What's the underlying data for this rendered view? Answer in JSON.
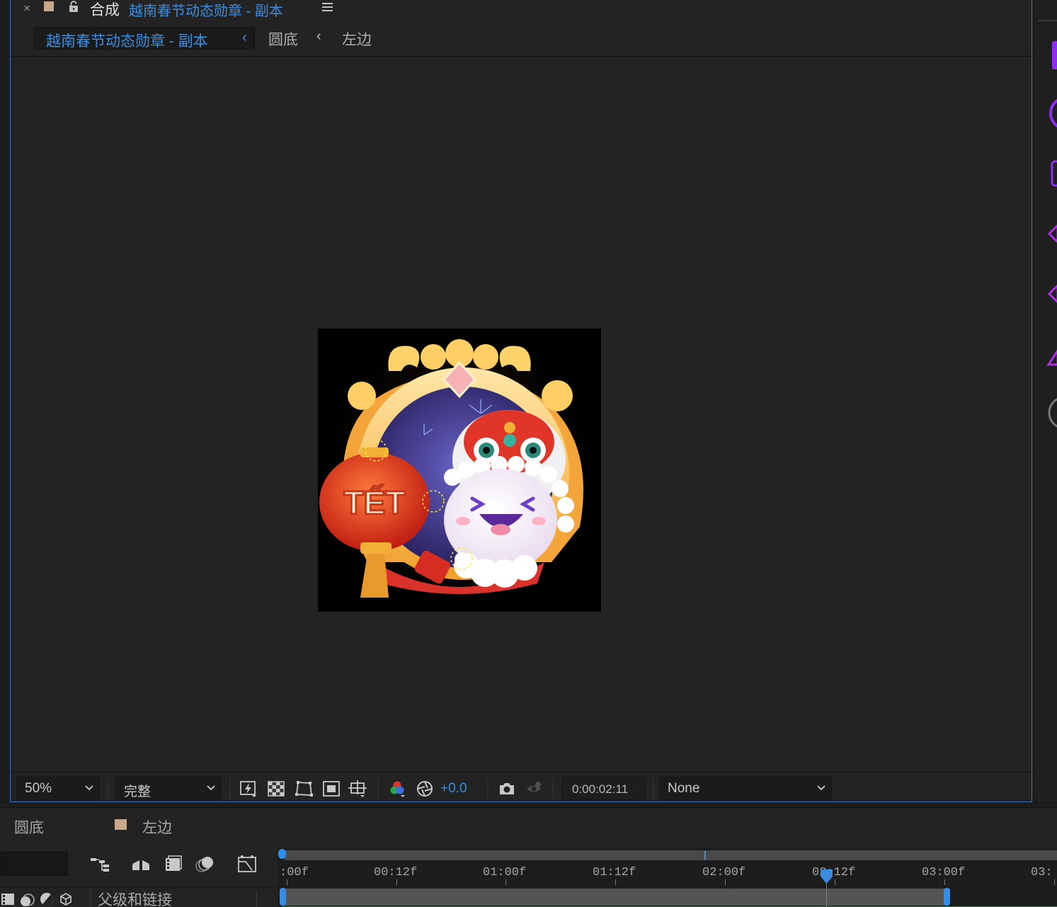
{
  "panel_tab": {
    "close_glyph": "×",
    "prefix": "合成",
    "comp_name": "越南春节动态勋章 - 副本"
  },
  "breadcrumbs": [
    {
      "label": "越南春节动态勋章 - 副本",
      "active": true
    },
    {
      "label": "圆底",
      "active": false
    },
    {
      "label": "左边",
      "active": false
    }
  ],
  "artwork": {
    "badge_text": "TẾT"
  },
  "viewer_bar": {
    "zoom": "50%",
    "resolution": "完整",
    "exposure": "+0.0",
    "timecode": "0:00:02:11",
    "view_option": "None"
  },
  "timeline": {
    "tabs": [
      {
        "label": "圆底",
        "swatch": null
      },
      {
        "label": "左边",
        "swatch": "#c8a888"
      }
    ],
    "column_header": "父级和链接",
    "ruler_ticks": [
      ":00f",
      "00:12f",
      "01:00f",
      "01:12f",
      "02:00f",
      "02:12f",
      "03:00f",
      "03:"
    ]
  },
  "colors": {
    "accent_blue": "#3b8de0",
    "label_swatch": "#c8a888",
    "panel_bg": "#232323"
  },
  "icons": [
    "close-icon",
    "lock-icon",
    "panel-menu-icon",
    "chevron-left-icon",
    "chevron-down-icon",
    "fast-preview-icon",
    "transparency-grid-icon",
    "mask-outline-icon",
    "region-of-interest-icon",
    "guides-icon",
    "color-channels-icon",
    "exposure-icon",
    "snapshot-camera-icon",
    "show-snapshot-icon",
    "composition-flowchart-icon",
    "draft-3d-icon",
    "frame-blending-icon",
    "motion-blur-icon",
    "graph-editor-icon",
    "playhead-icon"
  ]
}
